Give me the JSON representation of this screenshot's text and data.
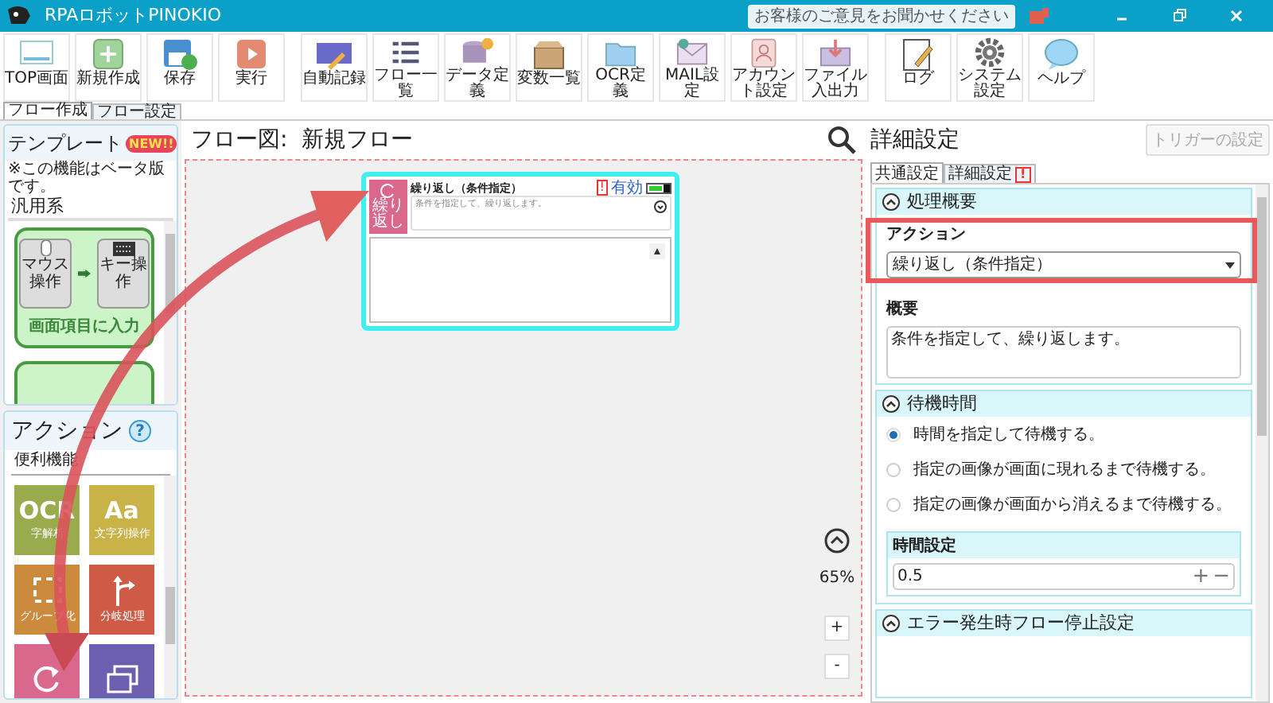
{
  "titlebar": {
    "title": "RPAロボットPINOKIO",
    "feedback": "お客様のご意見をお聞かせください"
  },
  "toolbar": [
    [
      {
        "label": "TOP画面"
      },
      {
        "label": "新規作成"
      },
      {
        "label": "保存"
      },
      {
        "label": "実行"
      }
    ],
    [
      {
        "label": "自動記録"
      },
      {
        "label": "フロー一覧"
      },
      {
        "label": "データ定義"
      },
      {
        "label": "変数一覧"
      },
      {
        "label": "OCR定義"
      },
      {
        "label": "MAIL設定"
      },
      {
        "label": "アカウント設定"
      },
      {
        "label": "ファイル入出力"
      }
    ],
    [
      {
        "label": "ログ"
      },
      {
        "label": "システム設定"
      },
      {
        "label": "ヘルプ"
      }
    ]
  ],
  "main_tabs": [
    {
      "label": "フロー作成",
      "selected": true
    },
    {
      "label": "フロー設定",
      "selected": false
    }
  ],
  "template_panel": {
    "title": "テンプレート",
    "badge": "NEW!!",
    "note": "※この機能はベータ版です。",
    "category": "汎用系",
    "template": {
      "label": "画面項目に入力",
      "from": "マウス操作",
      "to": "キー操作"
    }
  },
  "action_panel": {
    "title": "アクション",
    "help": "?",
    "category": "便利機能",
    "tiles": [
      {
        "glyph": "OCR",
        "label": "字解析",
        "color": "#9aab4d"
      },
      {
        "glyph": "Aa",
        "label": "文字列操作",
        "color": "#c9b349"
      },
      {
        "label": "グループ化",
        "color": "#cc8a3e"
      },
      {
        "label": "分岐処理",
        "color": "#cf5b47"
      },
      {
        "color": "#d9688c"
      },
      {
        "color": "#6d5fb0"
      }
    ]
  },
  "flow": {
    "title": "フロー図:  新規フロー",
    "zoom": "65%",
    "zoom_in": "+",
    "zoom_out": "-",
    "node": {
      "title": "繰り返し（条件指定）",
      "icon_label": "繰り返し",
      "status": "有効",
      "description": "条件を指定して、繰り返します。",
      "warning": "!"
    }
  },
  "detail": {
    "title": "詳細設定",
    "trigger_button": {
      "label": "トリガーの設定",
      "disabled": true
    },
    "tabs": [
      {
        "label": "共通設定",
        "selected": true
      },
      {
        "label": "詳細設定",
        "selected": false,
        "badge": "!"
      }
    ],
    "summary_section": {
      "title": "処理概要",
      "action_label": "アクション",
      "action_value": "繰り返し（条件指定）",
      "summary_label": "概要",
      "summary_value": "条件を指定して、繰り返します。"
    },
    "wait_section": {
      "title": "待機時間",
      "options": [
        {
          "label": "時間を指定して待機する。",
          "selected": true
        },
        {
          "label": "指定の画像が画面に現れるまで待機する。",
          "selected": false
        },
        {
          "label": "指定の画像が画面から消えるまで待機する。",
          "selected": false
        }
      ],
      "time_label": "時間設定",
      "time_value": "0.5",
      "plus": "+",
      "minus": "−"
    },
    "error_section": {
      "title": "エラー発生時フロー停止設定"
    }
  }
}
